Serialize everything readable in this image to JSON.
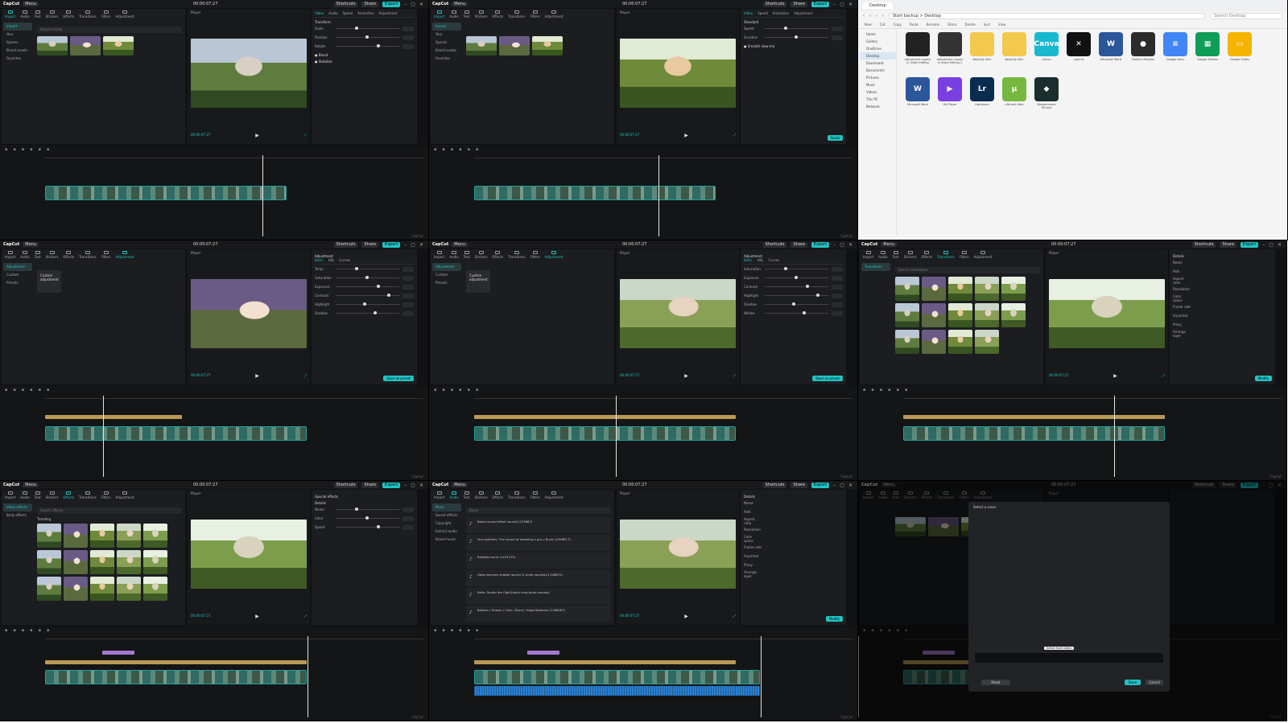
{
  "app": {
    "name": "CapCut",
    "menu": "Menu",
    "shortcuts": "Shortcuts",
    "share": "Share",
    "export": "Export",
    "preview_title": "Player",
    "timecode": "00:00:07:27"
  },
  "tiles": [
    {
      "left_tab_active": "Import",
      "left_tabs": [
        "Import",
        "Audio",
        "Text",
        "Stickers",
        "Effects",
        "Transitions",
        "Filters",
        "Adjustment"
      ],
      "side": [
        "Import",
        "Your",
        "Spaces",
        "Brand assets",
        "Favorites"
      ],
      "search": "Search media",
      "right_tabs": [
        "Video",
        "Audio",
        "Speed",
        "Animation",
        "Adjustment"
      ],
      "right_section": "Transform",
      "right_rows": [
        "Scale",
        "Position",
        "Rotate"
      ],
      "right_extra": [
        "Blend",
        "Stabilize"
      ]
    },
    {
      "left_tab_active": "Import",
      "side": [
        "Import",
        "Your",
        "Spaces",
        "Brand assets",
        "Favorites"
      ],
      "right_tabs": [
        "Video",
        "Speed",
        "Animation",
        "Adjustment"
      ],
      "right_section": "Standard",
      "right_rows": [
        "Speed",
        "Duration"
      ],
      "right_extra": [
        "Smooth slow-mo"
      ],
      "save": "Reset"
    },
    {
      "explorer": true
    },
    {
      "left_tab_active": "Adjustment",
      "side": [
        "Adjustment",
        "Custom",
        "Presets"
      ],
      "card": "Custom adjustment",
      "right_title": "Adjustment",
      "right_tabs": [
        "Basic",
        "HSL",
        "Curves"
      ],
      "right_rows": [
        "Temp",
        "Saturation",
        "Exposure",
        "Contrast",
        "Highlight",
        "Shadow"
      ],
      "save": "Save as preset"
    },
    {
      "left_tab_active": "Adjustment",
      "side": [
        "Adjustment",
        "Custom",
        "Presets"
      ],
      "card": "Custom adjustment",
      "right_title": "Adjustment",
      "right_tabs": [
        "Basic",
        "HSL",
        "Curves"
      ],
      "right_rows": [
        "Saturation",
        "Exposure",
        "Contrast",
        "Highlight",
        "Shadow",
        "Whites"
      ],
      "save": "Save as preset"
    },
    {
      "left_tab_active": "Transitions",
      "side": [
        "Transitions"
      ],
      "search": "Search transitions",
      "right_title": "Details",
      "right_rows": [
        "Name",
        "Path",
        "Aspect ratio",
        "Resolution",
        "Color space",
        "Frame rate",
        "Imported",
        "Proxy",
        "Arrange layer"
      ],
      "save": "Modify"
    },
    {
      "left_tab_active": "Effects",
      "side": [
        "Video effects",
        "Body effects"
      ],
      "search": "Search effects",
      "list_head": "Trending",
      "right_title": "Special effects",
      "right_section": "Details",
      "right_rows": [
        "Name",
        "Color",
        "Speed"
      ]
    },
    {
      "left_tab_active": "Audio",
      "side": [
        "Music",
        "Sound effects",
        "Copyright",
        "Extract audio",
        "Brand music"
      ],
      "search": "Boom",
      "sounds": [
        "Boom sound effect sound(1133887)",
        "Von qualities: The sound of shooting a gun / Burst (1098617)",
        "Bubbles burst (1102175)",
        "Glass burners shatter sound (1 burst sounds)(1198870)",
        "Bells: Studio fire (light)(with long burst sounds)",
        "Balloon / Smash / Click / Burst / Huge Balloons (1188087)"
      ],
      "right_title": "Details",
      "right_rows": [
        "Name",
        "Path",
        "Aspect ratio",
        "Resolution",
        "Color space",
        "Frame rate",
        "Imported",
        "Proxy",
        "Arrange layer"
      ],
      "save": "Modify"
    },
    {
      "dialog": true,
      "dialog_title": "Select a cover",
      "dialog_tip": "Select from video",
      "btn_left": "Reset",
      "btn_ok": "Done",
      "btn_cancel": "Cancel"
    }
  ],
  "explorer": {
    "tab": "Desktop",
    "path": "Start backup > Desktop",
    "search": "Search Desktop",
    "toolbar": [
      "New",
      "Cut",
      "Copy",
      "Paste",
      "Rename",
      "Share",
      "Delete",
      "Sort",
      "View"
    ],
    "nav": [
      "Home",
      "Gallery",
      "OneDrive",
      "Desktop",
      "Downloads",
      "Documents",
      "Pictures",
      "Music",
      "Videos",
      "This PC",
      "Network"
    ],
    "icons": [
      {
        "name": "Adjustment Layers in Video Editing",
        "color": "#222",
        "glyph": ""
      },
      {
        "name": "Adjustment Layers in Video Editing 2",
        "color": "#333",
        "glyph": ""
      },
      {
        "name": "Beautify Skin",
        "color": "#f2c94c",
        "glyph": ""
      },
      {
        "name": "Beautify Skin",
        "color": "#f2c94c",
        "glyph": ""
      },
      {
        "name": "Canva",
        "color": "#19b8cf",
        "glyph": "Canva"
      },
      {
        "name": "CapCut",
        "color": "#111",
        "glyph": "✕"
      },
      {
        "name": "Microsoft Word",
        "color": "#2b579a",
        "glyph": "W"
      },
      {
        "name": "DaVinci Resolve",
        "color": "#2b2b2b",
        "glyph": "●"
      },
      {
        "name": "Google Docs",
        "color": "#4285f4",
        "glyph": "≡"
      },
      {
        "name": "Google Sheets",
        "color": "#0f9d58",
        "glyph": "▦"
      },
      {
        "name": "Google Slides",
        "color": "#f4b400",
        "glyph": "▭"
      },
      {
        "name": "Microsoft Word",
        "color": "#2b579a",
        "glyph": "W"
      },
      {
        "name": "VN Player",
        "color": "#7a3fe0",
        "glyph": "▶"
      },
      {
        "name": "Lightroom",
        "color": "#0a2c4e",
        "glyph": "Lr"
      },
      {
        "name": "uTorrent Web",
        "color": "#76b83f",
        "glyph": "µ"
      },
      {
        "name": "Wondershare Filmora",
        "color": "#1a2e2e",
        "glyph": "◆"
      }
    ]
  }
}
